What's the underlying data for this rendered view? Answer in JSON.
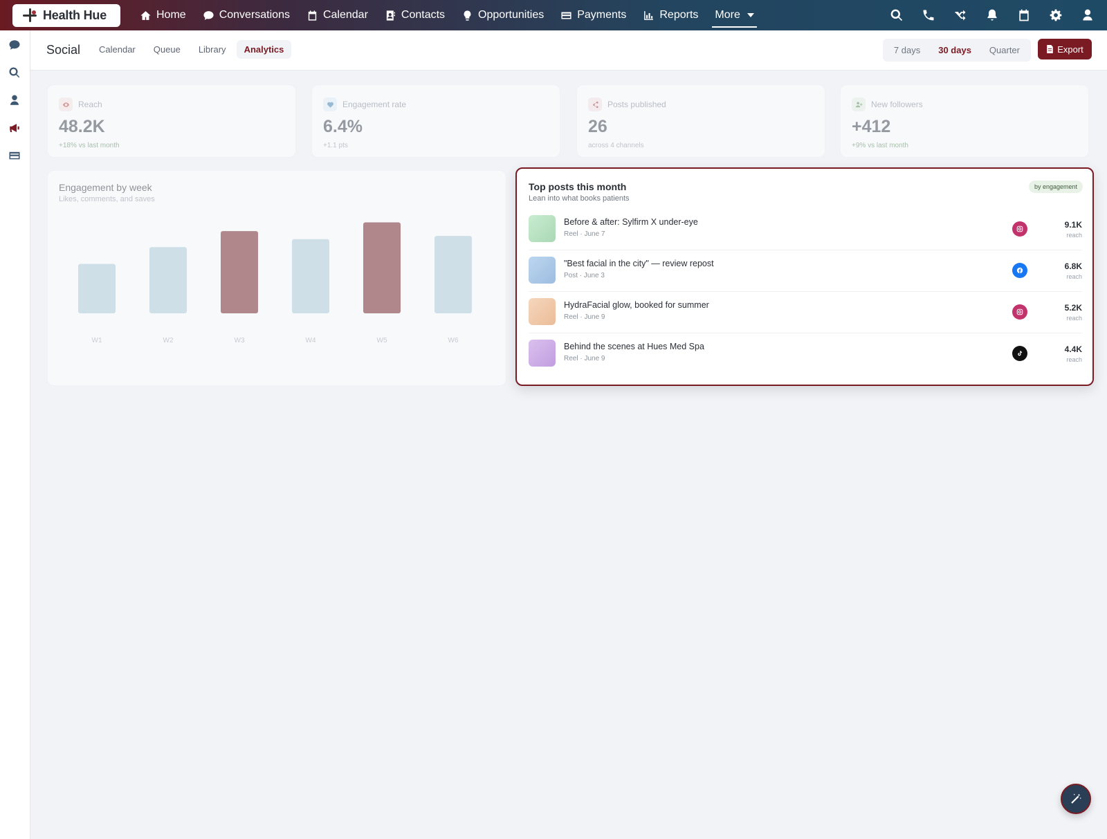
{
  "brand": {
    "name": "Health Hue"
  },
  "nav": {
    "items": [
      {
        "label": "Home",
        "icon": "home-icon"
      },
      {
        "label": "Conversations",
        "icon": "chat-bubble-icon"
      },
      {
        "label": "Calendar",
        "icon": "calendar-icon"
      },
      {
        "label": "Contacts",
        "icon": "contact-card-icon"
      },
      {
        "label": "Opportunities",
        "icon": "lightbulb-icon"
      },
      {
        "label": "Payments",
        "icon": "credit-card-icon"
      },
      {
        "label": "Reports",
        "icon": "bar-chart-icon"
      }
    ],
    "more_label": "More",
    "right_icons": [
      "search-icon",
      "phone-icon",
      "shuffle-icon",
      "bell-icon",
      "calendar-icon",
      "gear-icon",
      "user-icon"
    ]
  },
  "rail": {
    "icons": [
      "chat-bubble-icon",
      "search-icon",
      "user-icon",
      "megaphone-icon",
      "credit-card-icon"
    ],
    "active": "megaphone-icon"
  },
  "subheader": {
    "title": "Social",
    "tabs": [
      "Calendar",
      "Queue",
      "Library",
      "Analytics"
    ],
    "active_tab": "Analytics",
    "ranges": [
      "7 days",
      "30 days",
      "Quarter"
    ],
    "active_range": "30 days",
    "export_label": "Export"
  },
  "stats": [
    {
      "label": "Reach",
      "value": "48.2K",
      "note": "+18% vs last month",
      "icon": "eye-icon",
      "color": "#c0392b"
    },
    {
      "label": "Engagement rate",
      "value": "6.4%",
      "note": "+1.1 pts",
      "icon": "heart-icon",
      "color": "#3b7fb0"
    },
    {
      "label": "Posts published",
      "value": "26",
      "note": "across 4 channels",
      "icon": "share-icon",
      "color": "#a0303a"
    },
    {
      "label": "New followers",
      "value": "+412",
      "note": "+9% vs last month",
      "icon": "user-plus-icon",
      "color": "#5b8a5b"
    }
  ],
  "engagement_chart": {
    "title": "Engagement by week",
    "subtitle": "Likes, comments, and saves"
  },
  "chart_data": {
    "type": "bar",
    "categories": [
      "W1",
      "W2",
      "W3",
      "W4",
      "W5",
      "W6"
    ],
    "values": [
      62,
      83,
      103,
      93,
      114,
      97
    ],
    "highlight": [
      "W3",
      "W5"
    ],
    "colors": {
      "normal": "#aacad9",
      "highlight": "#6e1a1f"
    },
    "ylim": [
      0,
      130
    ],
    "grid": false,
    "title": "Engagement by week",
    "subtitle": "Likes, comments, and saves",
    "xlabel": "",
    "ylabel": ""
  },
  "top_posts": {
    "title": "Top posts this month",
    "subtitle": "Lean into what books patients",
    "badge": "by engagement",
    "rows": [
      {
        "title": "Before & after: Sylfirm X under-eye",
        "meta": "Reel · June 7",
        "network": "instagram-icon",
        "reach": "9.1K",
        "reach_label": "reach",
        "thumb_color": "#b8e0c0",
        "network_color": "#c2336b"
      },
      {
        "title": "\"Best facial in the city\" — review repost",
        "meta": "Post · June 3",
        "network": "facebook-icon",
        "reach": "6.8K",
        "reach_label": "reach",
        "thumb_color": "#acc9e6",
        "network_color": "#1877f2"
      },
      {
        "title": "HydraFacial glow, booked for summer",
        "meta": "Reel · June 9",
        "network": "instagram-icon",
        "reach": "5.2K",
        "reach_label": "reach",
        "thumb_color": "#f1c9a8",
        "network_color": "#c2336b"
      },
      {
        "title": "Behind the scenes at Hues Med Spa",
        "meta": "Reel · June 9",
        "network": "tiktok-icon",
        "reach": "4.4K",
        "reach_label": "reach",
        "thumb_color": "#cfb0e6",
        "network_color": "#111111"
      }
    ]
  },
  "fab": {
    "icon": "magic-wand-icon"
  },
  "colors": {
    "accent": "#7a1b24",
    "nav_start": "#6a1b22",
    "nav_end": "#1f4a66"
  }
}
